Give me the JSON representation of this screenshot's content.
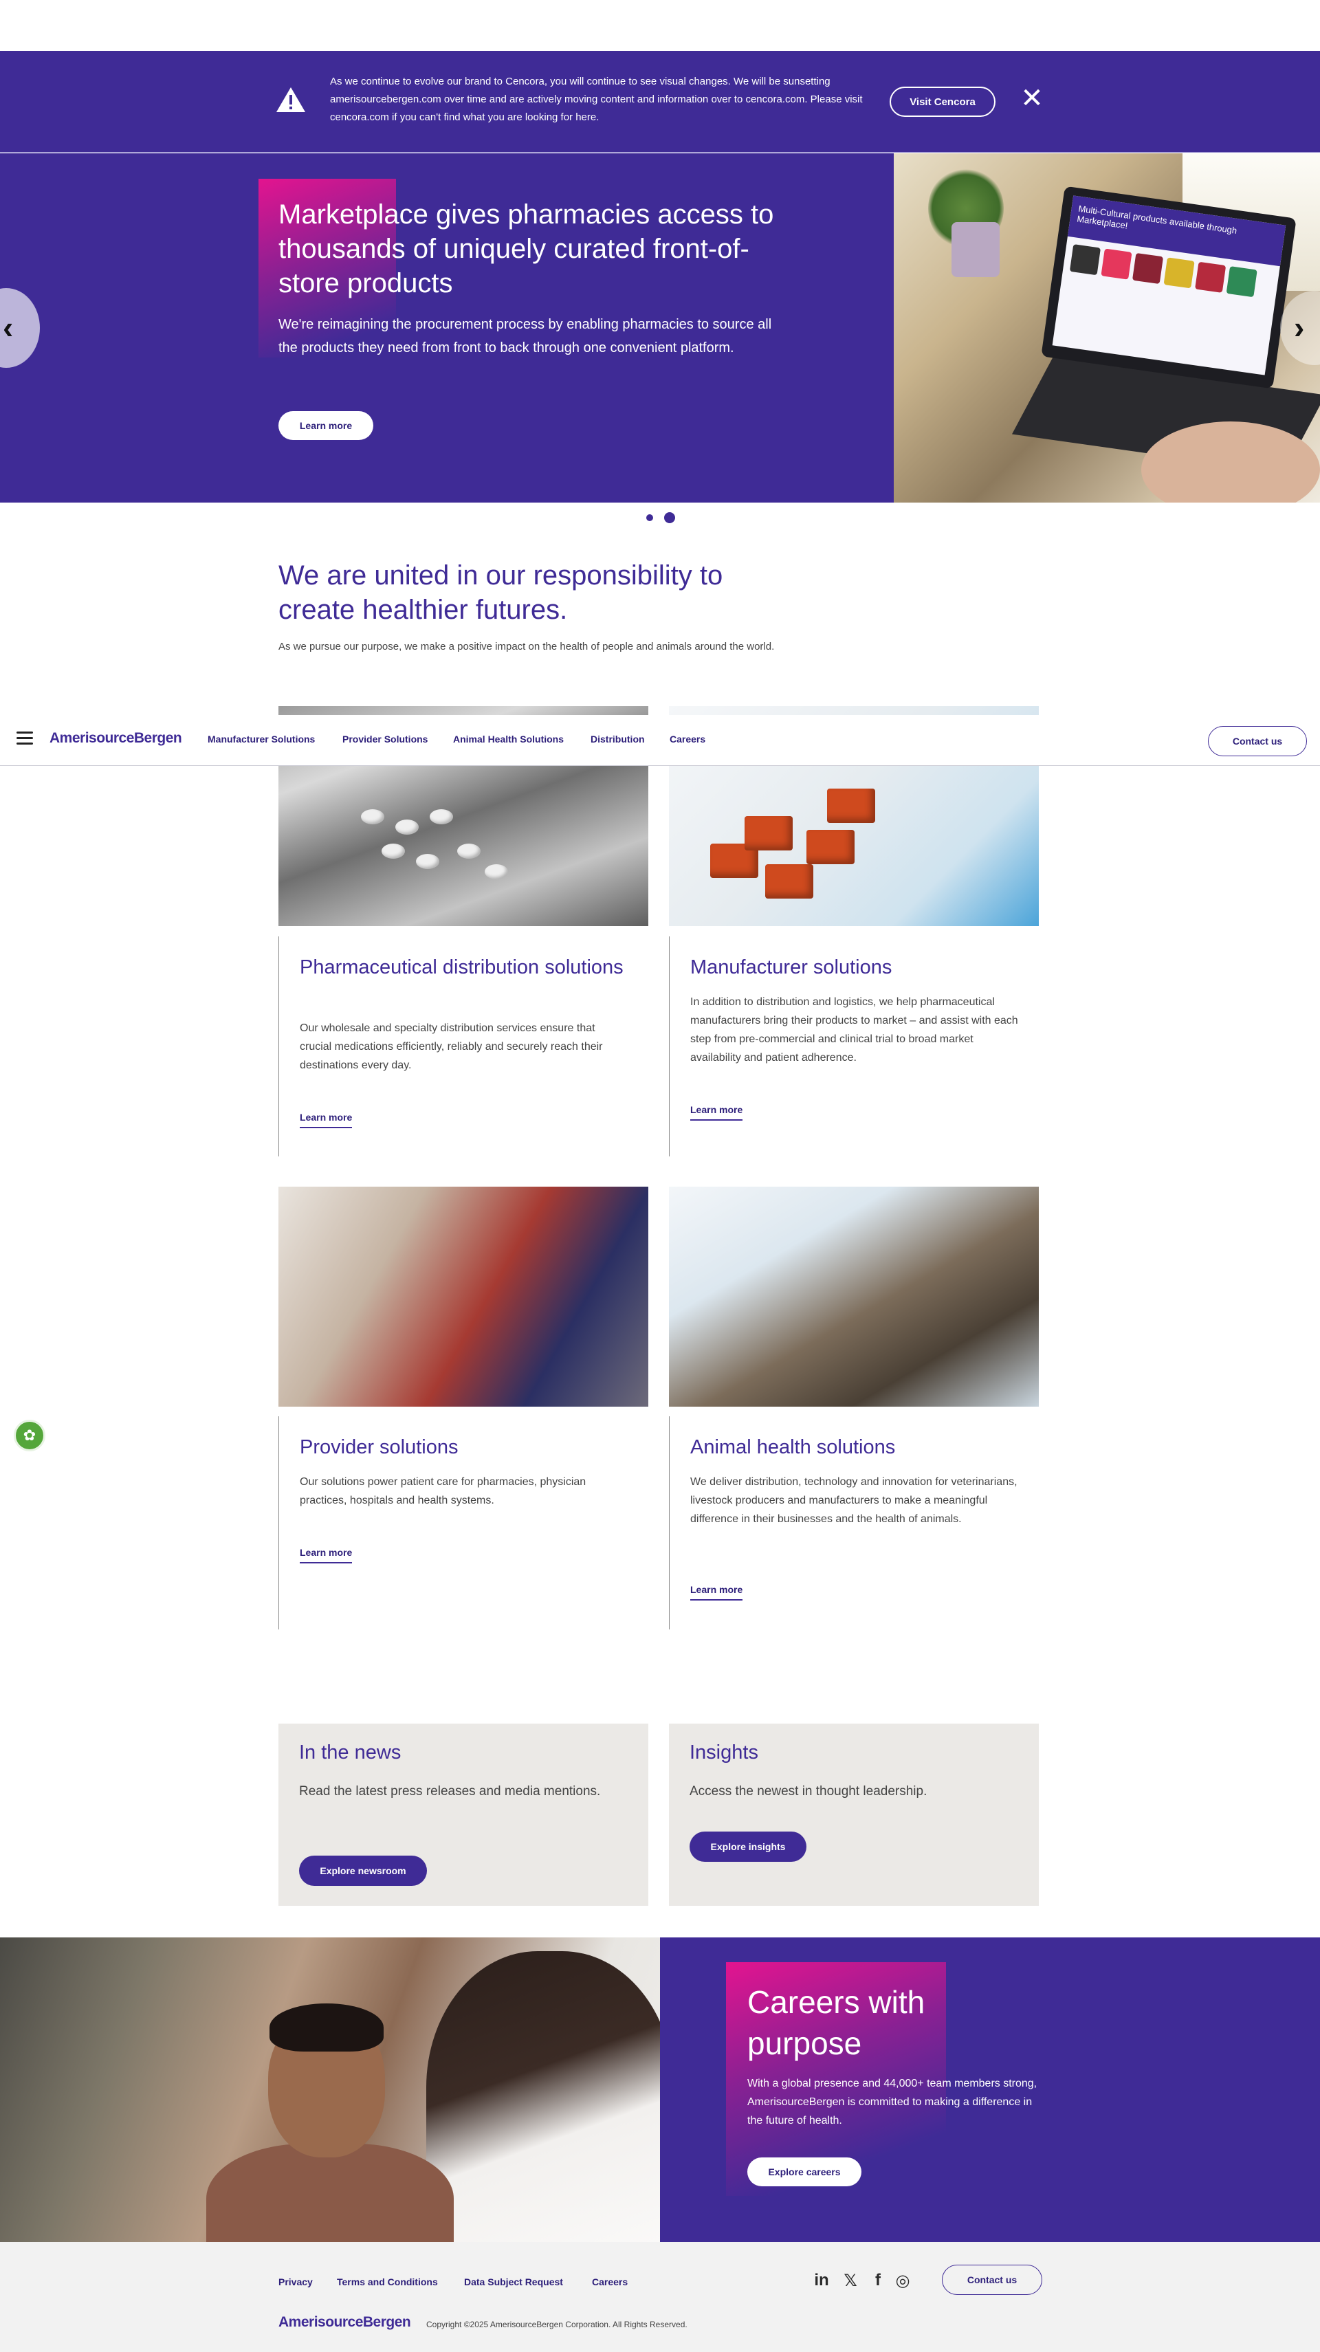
{
  "banner": {
    "text": "As we continue to evolve our brand to Cencora, you will continue to see visual changes. We will be sunsetting amerisourcebergen.com over time and are actively moving content and information over to cencora.com. Please visit cencora.com if you can't find what you are looking for here.",
    "button": "Visit Cencora",
    "close": "✕",
    "warning_icon": "warning-triangle-icon"
  },
  "hero": {
    "title": "Marketplace gives pharmacies access to thousands of uniquely curated front-of-store products",
    "body": "We're reimagining the procurement process by enabling pharmacies to source all the products they need from front to back through one convenient platform.",
    "button": "Learn more",
    "screen_text": "Multi-Cultural products available through Marketplace!",
    "prev_glyph": "‹",
    "next_glyph": "›",
    "slide_count": 2,
    "active_slide": 2
  },
  "intro": {
    "title": "We are united in our responsibility to create healthier futures.",
    "subtitle": "As we pursue our purpose, we make a positive impact on the health of people and animals around the world."
  },
  "nav": {
    "logo": "AmerisourceBergen",
    "links": [
      "Manufacturer Solutions",
      "Provider Solutions",
      "Animal Health Solutions",
      "Distribution",
      "Careers"
    ],
    "contact": "Contact us"
  },
  "cards": [
    {
      "title": "Pharmaceutical distribution solutions",
      "text": "Our wholesale and specialty distribution services ensure that crucial medications efficiently, reliably and securely reach their destinations every day.",
      "link": "Learn more"
    },
    {
      "title": "Manufacturer solutions",
      "text": "In addition to distribution and logistics, we help pharmaceutical manufacturers bring their products to market – and assist with each step from pre-commercial and clinical trial to broad market availability and patient adherence.",
      "link": "Learn more"
    },
    {
      "title": "Provider solutions",
      "text": "Our solutions power patient care for pharmacies, physician practices, hospitals and health systems.",
      "link": "Learn more"
    },
    {
      "title": "Animal health solutions",
      "text": "We deliver distribution, technology and innovation for veterinarians, livestock producers and manufacturers to make a meaningful difference in their businesses and the health of animals.",
      "link": "Learn more"
    }
  ],
  "tiles": [
    {
      "title": "In the news",
      "text": "Read the latest press releases and media mentions.",
      "button": "Explore newsroom"
    },
    {
      "title": "Insights",
      "text": "Access the newest in thought leadership.",
      "button": "Explore insights"
    }
  ],
  "careers": {
    "title": "Careers with purpose",
    "text": "With a global presence and 44,000+ team members strong, AmerisourceBergen is committed to making a difference in the future of health.",
    "button": "Explore careers"
  },
  "footer": {
    "links": [
      "Privacy",
      "Terms and Conditions",
      "Data Subject Request",
      "Careers"
    ],
    "social": [
      {
        "icon": "linkedin-icon",
        "glyph": "in"
      },
      {
        "icon": "x-twitter-icon",
        "glyph": "𝕏"
      },
      {
        "icon": "facebook-icon",
        "glyph": "f"
      },
      {
        "icon": "instagram-icon",
        "glyph": "◎"
      }
    ],
    "contact": "Contact us",
    "logo": "AmerisourceBergen",
    "copyright": "Copyright ©2025 AmerisourceBergen Corporation. All Rights Reserved."
  },
  "cookie": {
    "icon": "cookie-settings-icon",
    "glyph": "✿"
  },
  "colors": {
    "brand_purple": "#3f2b96",
    "accent_magenta": "#e3148f",
    "tile_bg": "#ebe9e6",
    "footer_bg": "#f2f2f2"
  }
}
